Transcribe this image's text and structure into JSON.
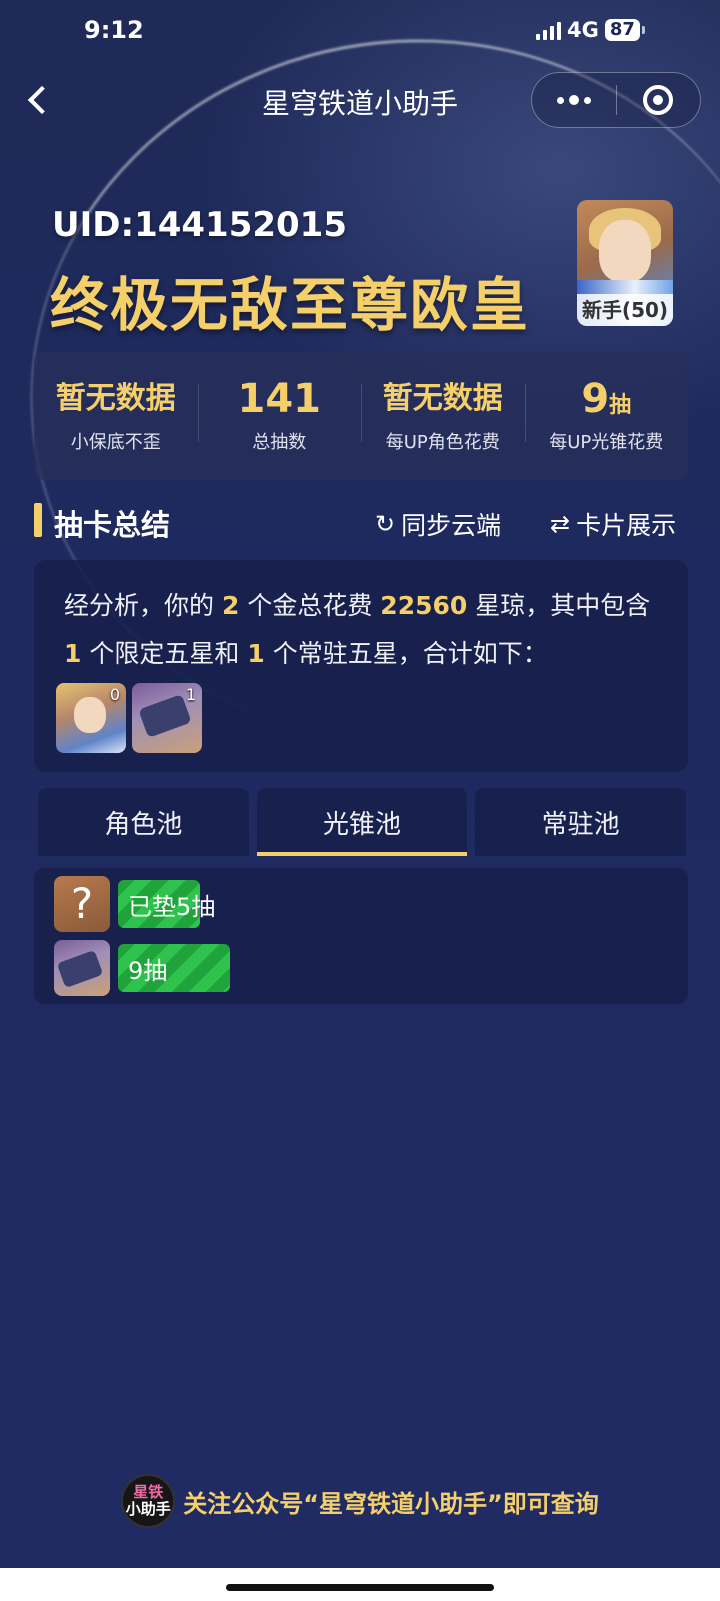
{
  "status_bar": {
    "time": "9:12",
    "network": "4G",
    "battery": "87"
  },
  "nav": {
    "title": "星穹铁道小助手"
  },
  "header": {
    "uid": "UID:144152015",
    "rank_title": "终极无敌至尊欧皇",
    "avatar_level": "新手(50)"
  },
  "stats": [
    {
      "value": "暂无数据",
      "unit": "",
      "label": "小保底不歪"
    },
    {
      "value": "141",
      "unit": "",
      "label": "总抽数"
    },
    {
      "value": "暂无数据",
      "unit": "",
      "label": "每UP角色花费"
    },
    {
      "value": "9",
      "unit": "抽",
      "label": "每UP光锥花费"
    }
  ],
  "section": {
    "title": "抽卡总结",
    "sync_label": "同步云端",
    "cards_label": "卡片展示"
  },
  "summary": {
    "p1": "经分析，你的",
    "gold_count": "2",
    "p2": "个金总花费",
    "cost": "22560",
    "p3": "星琼，其中包含",
    "limited_count": "1",
    "p4": "个限定五星和",
    "standard_count": "1",
    "p5": "个常驻五星，合计如下：",
    "thumbs": [
      {
        "count": "0"
      },
      {
        "count": "1"
      }
    ]
  },
  "tabs": [
    {
      "label": "角色池"
    },
    {
      "label": "光锥池"
    },
    {
      "label": "常驻池"
    }
  ],
  "active_tab": "光锥池",
  "records": [
    {
      "icon_text": "?",
      "label": "已垫5抽"
    },
    {
      "icon_text": "",
      "label": "9抽"
    }
  ],
  "footer": {
    "logo_line1": "星铁",
    "logo_line2": "小助手",
    "text": "关注公众号“星穹铁道小助手”即可查询"
  },
  "colors": {
    "accent": "#f4cf6a",
    "background": "#1d2856",
    "bar_green": "#1fa33a"
  }
}
